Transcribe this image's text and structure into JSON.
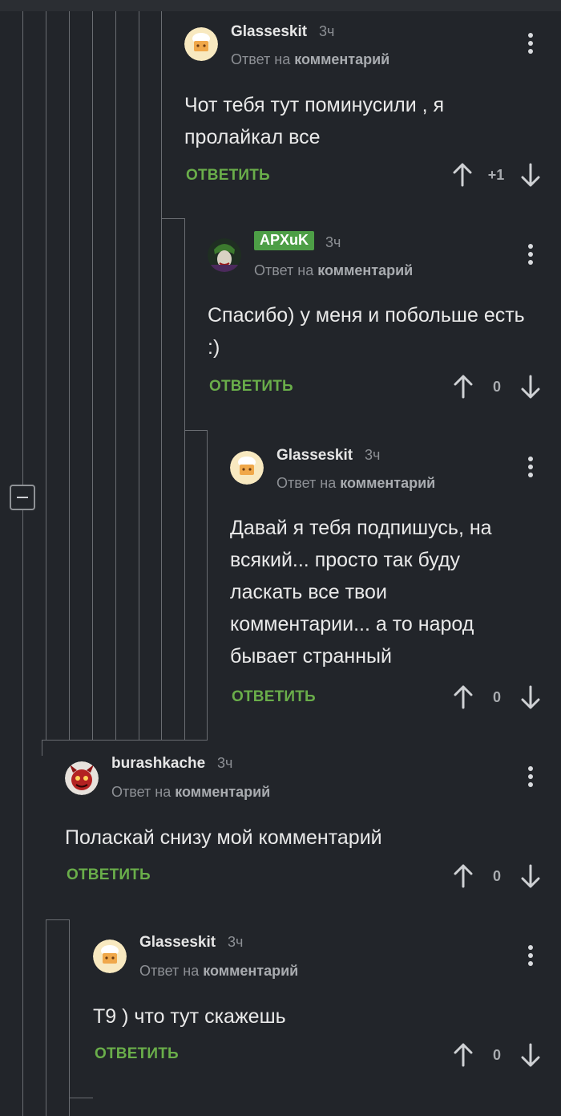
{
  "comments": [
    {
      "author": "Glasseskit",
      "time": "3ч",
      "reply_prefix": "Ответ на",
      "reply_target": "комментарий",
      "text": "Чот тебя тут поминусили , я пролайкал все",
      "reply_label": "ОТВЕТИТЬ",
      "score": "+1",
      "avatar": "cook-hat-avatar"
    },
    {
      "author": "APXuK",
      "time": "3ч",
      "reply_prefix": "Ответ на",
      "reply_target": "комментарий",
      "text": "Спасибо) у меня и побольше есть :)",
      "reply_label": "ОТВЕТИТЬ",
      "score": "0",
      "avatar": "joker-avatar",
      "badge_color": "#4d9e46"
    },
    {
      "author": "Glasseskit",
      "time": "3ч",
      "reply_prefix": "Ответ на",
      "reply_target": "комментарий",
      "text": "Давай я тебя подпишусь, на всякий... просто так буду ласкать все твои комментарии... а то народ бывает странный",
      "reply_label": "ОТВЕТИТЬ",
      "score": "0",
      "avatar": "cook-hat-avatar"
    },
    {
      "author": "burashkache",
      "time": "3ч",
      "reply_prefix": "Ответ на",
      "reply_target": "комментарий",
      "text": "Поласкай снизу мой комментарий",
      "reply_label": "ОТВЕТИТЬ",
      "score": "0",
      "avatar": "red-creature-avatar"
    },
    {
      "author": "Glasseskit",
      "time": "3ч",
      "reply_prefix": "Ответ на",
      "reply_target": "комментарий",
      "text": "Т9 ) что тут скажешь",
      "reply_label": "ОТВЕТИТЬ",
      "score": "0",
      "avatar": "cook-hat-avatar"
    }
  ],
  "colors": {
    "background": "#22252a",
    "accent_green": "#6aae4a",
    "thread_line": "#6a6d72"
  },
  "icons": {
    "upvote": "arrow-up-icon",
    "downvote": "arrow-down-icon",
    "menu": "kebab-menu-icon",
    "collapse": "collapse-thread-icon"
  }
}
